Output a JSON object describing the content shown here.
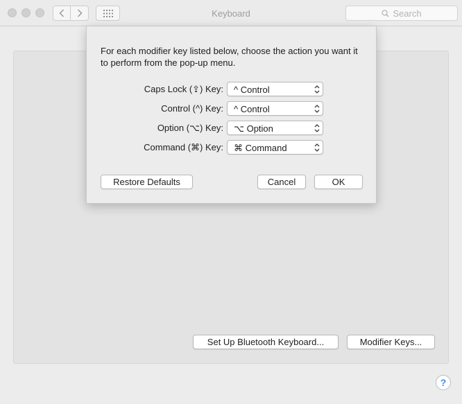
{
  "window": {
    "title": "Keyboard"
  },
  "toolbar": {
    "search_placeholder": "Search"
  },
  "main": {
    "bluetooth_button_label": "Set Up Bluetooth Keyboard...",
    "modifier_button_label": "Modifier Keys...",
    "help_label": "?"
  },
  "sheet": {
    "description": "For each modifier key listed below, choose the action you want it to perform from the pop-up menu.",
    "rows": [
      {
        "label": "Caps Lock (⇪) Key:",
        "value": "^ Control"
      },
      {
        "label": "Control (^) Key:",
        "value": "^ Control"
      },
      {
        "label": "Option (⌥) Key:",
        "value": "⌥ Option"
      },
      {
        "label": "Command (⌘) Key:",
        "value": "⌘ Command"
      }
    ],
    "restore_label": "Restore Defaults",
    "cancel_label": "Cancel",
    "ok_label": "OK"
  }
}
